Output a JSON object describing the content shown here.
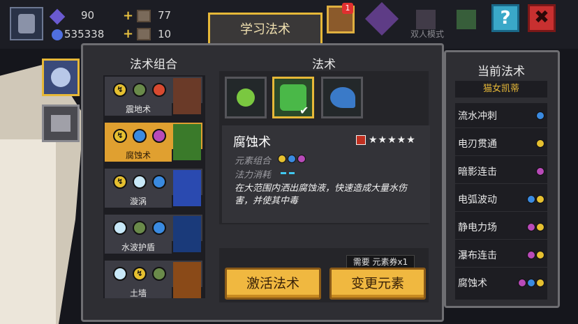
{
  "hud": {
    "gems": "90",
    "coins": "535338",
    "mat1": "77",
    "mat2": "10",
    "chest_badge": "1",
    "mode_label": "双人模式",
    "help_label": "?",
    "close_label": "✖"
  },
  "learn_tab": "学习法术",
  "combos": {
    "title": "法术组合",
    "items": [
      {
        "label": "震地术"
      },
      {
        "label": "腐蚀术"
      },
      {
        "label": "漩涡"
      },
      {
        "label": "水波护盾"
      },
      {
        "label": "土墙"
      }
    ]
  },
  "spells": {
    "title": "法术",
    "name": "腐蚀术",
    "stars": "★★★★★",
    "element_label": "元素组合",
    "mana_label": "法力消耗",
    "description": "在大范围内洒出腐蚀液，快速造成大量水伤害，并使其中毒",
    "requirement": "需要 元素券x1",
    "activate_btn": "激活法术",
    "change_btn": "变更元素"
  },
  "current": {
    "title": "当前法术",
    "hero": "猫女凯蒂",
    "items": [
      {
        "name": "流水冲刺"
      },
      {
        "name": "电刃贯通"
      },
      {
        "name": "暗影连击"
      },
      {
        "name": "电弧波动"
      },
      {
        "name": "静电力场"
      },
      {
        "name": "瀑布连击"
      },
      {
        "name": "腐蚀术"
      }
    ]
  },
  "colors": {
    "accent": "#e6b838",
    "panel": "#2e2e33",
    "lightning": "#e6c030",
    "water": "#3a8ae0",
    "poison": "#b84ab8",
    "earth": "#6a8a4a",
    "fire": "#d84a30",
    "ice": "#c8e8f8"
  }
}
